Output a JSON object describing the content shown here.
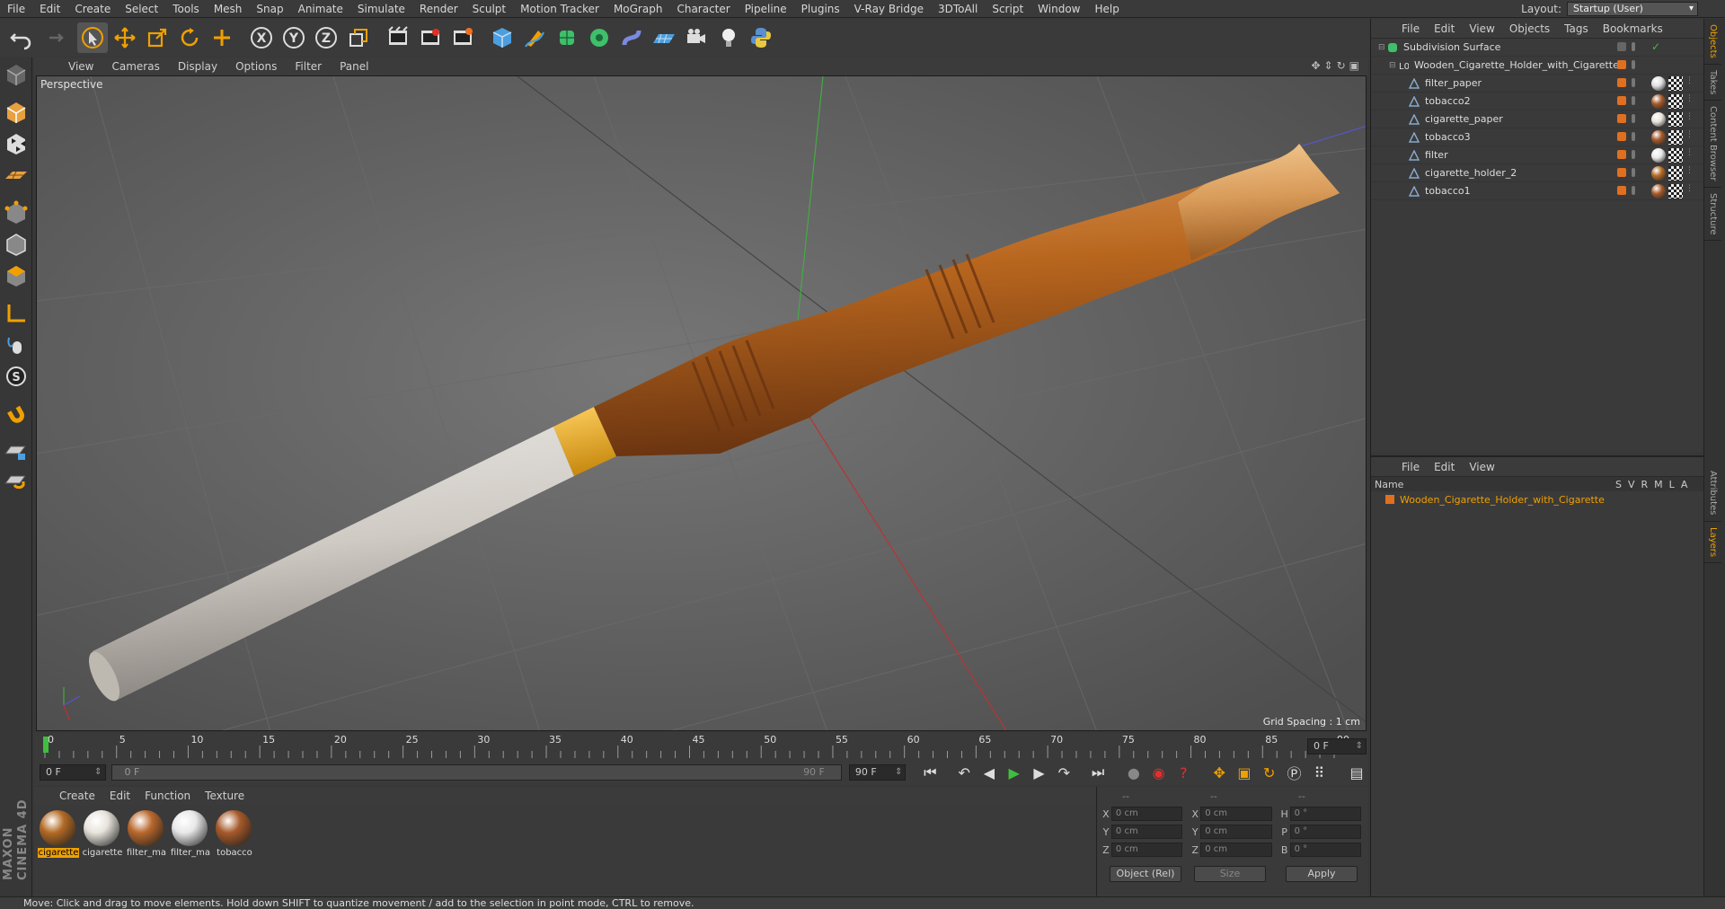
{
  "menubar": {
    "items": [
      "File",
      "Edit",
      "Create",
      "Select",
      "Tools",
      "Mesh",
      "Snap",
      "Animate",
      "Simulate",
      "Render",
      "Sculpt",
      "Motion Tracker",
      "MoGraph",
      "Character",
      "Pipeline",
      "Plugins",
      "V-Ray Bridge",
      "3DToAll",
      "Script",
      "Window",
      "Help"
    ],
    "layout_label": "Layout:",
    "layout_value": "Startup (User)"
  },
  "toolbar": {
    "icons": [
      "undo-icon",
      "redo-icon",
      "live-select-icon",
      "move-icon",
      "scale-icon",
      "rotate-icon",
      "add-icon",
      "x-axis-icon",
      "y-axis-icon",
      "z-axis-icon",
      "world-coordinates-icon",
      "render-view-icon",
      "render-picture-viewer-icon",
      "edit-render-settings-icon",
      "cube-icon",
      "pen-icon",
      "subdivision-icon",
      "array-icon",
      "deformer-icon",
      "floor-icon",
      "camera-icon",
      "light-icon",
      "python-icon"
    ]
  },
  "leftbar": {
    "icons": [
      "make-editable-icon",
      "model-mode-icon",
      "texture-mode-icon",
      "workplane-icon",
      "points-mode-icon",
      "edges-mode-icon",
      "polygons-mode-icon",
      "axis-mode-icon",
      "tweak-icon",
      "solo-icon",
      "snap-icon",
      "workplane-lock-icon",
      "grid-snap-icon"
    ],
    "brand": "MAXON CINEMA 4D"
  },
  "viewport": {
    "menu": [
      "View",
      "Cameras",
      "Display",
      "Options",
      "Filter",
      "Panel"
    ],
    "label": "Perspective",
    "grid_spacing": "Grid Spacing : 1 cm"
  },
  "timeline": {
    "ticks": [
      "0",
      "5",
      "10",
      "15",
      "20",
      "25",
      "30",
      "35",
      "40",
      "45",
      "50",
      "55",
      "60",
      "65",
      "70",
      "75",
      "80",
      "85",
      "90"
    ],
    "current_frame": "0 F"
  },
  "transport": {
    "start": "0 F",
    "slider_start": "0 F",
    "slider_end": "90 F",
    "end": "90 F"
  },
  "materials": {
    "menu": [
      "Create",
      "Edit",
      "Function",
      "Texture"
    ],
    "items": [
      {
        "name": "cigarette",
        "color": "#b36a25",
        "selected": true
      },
      {
        "name": "cigarette",
        "color": "#e8e4dc",
        "selected": false
      },
      {
        "name": "filter_ma",
        "color": "#b9682d",
        "selected": false
      },
      {
        "name": "filter_ma",
        "color": "#e8e8e8",
        "selected": false
      },
      {
        "name": "tobacco",
        "color": "#a65a2a",
        "selected": false
      }
    ]
  },
  "coords": {
    "header": [
      "--",
      "--",
      "--"
    ],
    "rows": [
      {
        "a1": "X",
        "v1": "0 cm",
        "a2": "X",
        "v2": "0 cm",
        "a3": "H",
        "v3": "0 °"
      },
      {
        "a1": "Y",
        "v1": "0 cm",
        "a2": "Y",
        "v2": "0 cm",
        "a3": "P",
        "v3": "0 °"
      },
      {
        "a1": "Z",
        "v1": "0 cm",
        "a2": "Z",
        "v2": "0 cm",
        "a3": "B",
        "v3": "0 °"
      }
    ],
    "mode": "Object (Rel)",
    "size": "Size",
    "apply": "Apply"
  },
  "objects": {
    "menu": [
      "File",
      "Edit",
      "View",
      "Objects",
      "Tags",
      "Bookmarks"
    ],
    "rows": [
      {
        "name": "Subdivision Surface",
        "indent": 0,
        "icon": "subdivision-icon"
      },
      {
        "name": "Wooden_Cigarette_Holder_with_Cigarette",
        "indent": 1,
        "icon": "null-icon"
      },
      {
        "name": "filter_paper",
        "indent": 2,
        "icon": "polygon-icon",
        "tag": "#e0e0e0"
      },
      {
        "name": "tobacco2",
        "indent": 2,
        "icon": "polygon-icon",
        "tag": "#a65a2a"
      },
      {
        "name": "cigarette_paper",
        "indent": 2,
        "icon": "polygon-icon",
        "tag": "#e8e4dc"
      },
      {
        "name": "tobacco3",
        "indent": 2,
        "icon": "polygon-icon",
        "tag": "#a65a2a"
      },
      {
        "name": "filter",
        "indent": 2,
        "icon": "polygon-icon",
        "tag": "#e8e8e8"
      },
      {
        "name": "cigarette_holder_2",
        "indent": 2,
        "icon": "polygon-icon",
        "tag": "#b36a25"
      },
      {
        "name": "tobacco1",
        "indent": 2,
        "icon": "polygon-icon",
        "tag": "#a65a2a"
      }
    ]
  },
  "layers": {
    "menu": [
      "File",
      "Edit",
      "View"
    ],
    "head": "Name",
    "cols": [
      "S",
      "V",
      "R",
      "M",
      "L",
      "A"
    ],
    "row": "Wooden_Cigarette_Holder_with_Cigarette"
  },
  "vtabs": [
    "Objects",
    "Takes",
    "Content Browser",
    "Structure",
    "Attributes",
    "Layers"
  ],
  "status": "Move: Click and drag to move elements. Hold down SHIFT to quantize movement / add to the selection in point mode, CTRL to remove.",
  "colors": {
    "accent": "#f0a000",
    "layer": "#e07020",
    "viewport": "#5e5e5e"
  }
}
